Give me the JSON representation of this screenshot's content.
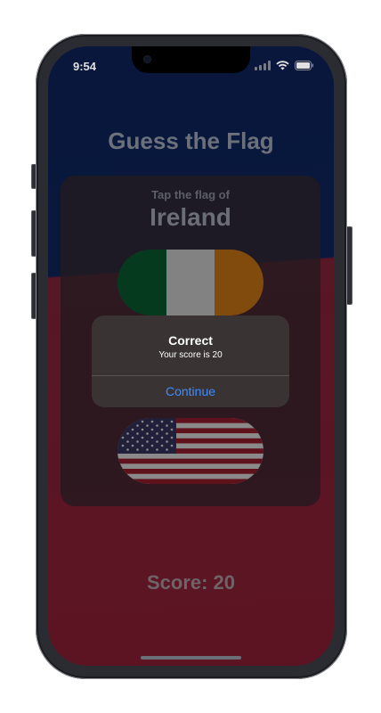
{
  "status_bar": {
    "time": "9:54"
  },
  "app": {
    "title": "Guess the Flag",
    "prompt": "Tap the flag of",
    "country": "Ireland",
    "score_text": "Score: 20"
  },
  "flags": [
    {
      "name": "Ireland",
      "colors": [
        "#0b6a3a",
        "#f1f1f1",
        "#f18a1c"
      ]
    },
    {
      "name": "United States",
      "colors": [
        "#b22234",
        "#ffffff",
        "#3c3b6e"
      ]
    }
  ],
  "alert": {
    "title": "Correct",
    "message": "Your score is 20",
    "button": "Continue"
  },
  "colors": {
    "accent": "#3f8cff",
    "background_top": "#0b1c45",
    "background_bottom": "#6a1727"
  }
}
